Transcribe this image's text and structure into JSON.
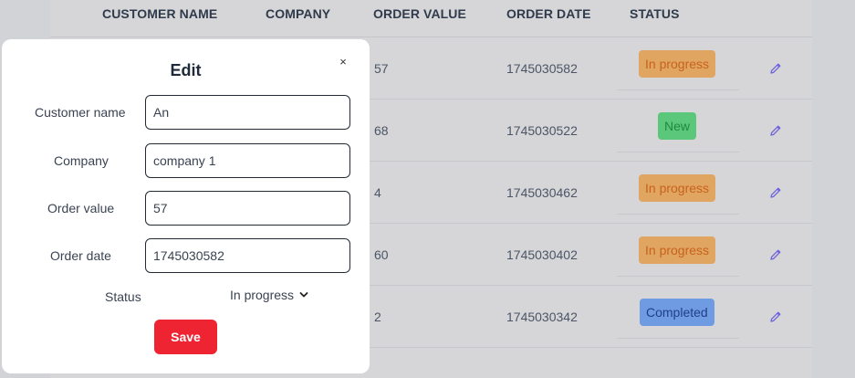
{
  "table": {
    "headers": [
      "CUSTOMER NAME",
      "COMPANY",
      "ORDER VALUE",
      "ORDER DATE",
      "STATUS"
    ],
    "rows": [
      {
        "order_value": "57",
        "order_date": "1745030582",
        "status": "In progress"
      },
      {
        "order_value": "68",
        "order_date": "1745030522",
        "status": "New"
      },
      {
        "order_value": "4",
        "order_date": "1745030462",
        "status": "In progress"
      },
      {
        "order_value": "60",
        "order_date": "1745030402",
        "status": "In progress"
      },
      {
        "order_value": "2",
        "order_date": "1745030342",
        "status": "Completed"
      }
    ]
  },
  "status_colors": {
    "In progress": {
      "bg": "#e0a560",
      "fg": "#c8621e"
    },
    "New": {
      "bg": "#5bc77a",
      "fg": "#1f8a3f"
    },
    "Completed": {
      "bg": "#6f9be2",
      "fg": "#1f3f8a"
    }
  },
  "icons": {
    "edit": "pencil-icon",
    "close": "close-icon",
    "dropdown": "chevron-down-icon"
  },
  "modal": {
    "title": "Edit",
    "close_glyph": "×",
    "fields": {
      "customer_name": {
        "label": "Customer name",
        "value": "An"
      },
      "company": {
        "label": "Company",
        "value": "company 1"
      },
      "order_value": {
        "label": "Order value",
        "value": "57"
      },
      "order_date": {
        "label": "Order date",
        "value": "1745030582"
      }
    },
    "status": {
      "label": "Status",
      "value": "In progress"
    },
    "save_label": "Save"
  }
}
